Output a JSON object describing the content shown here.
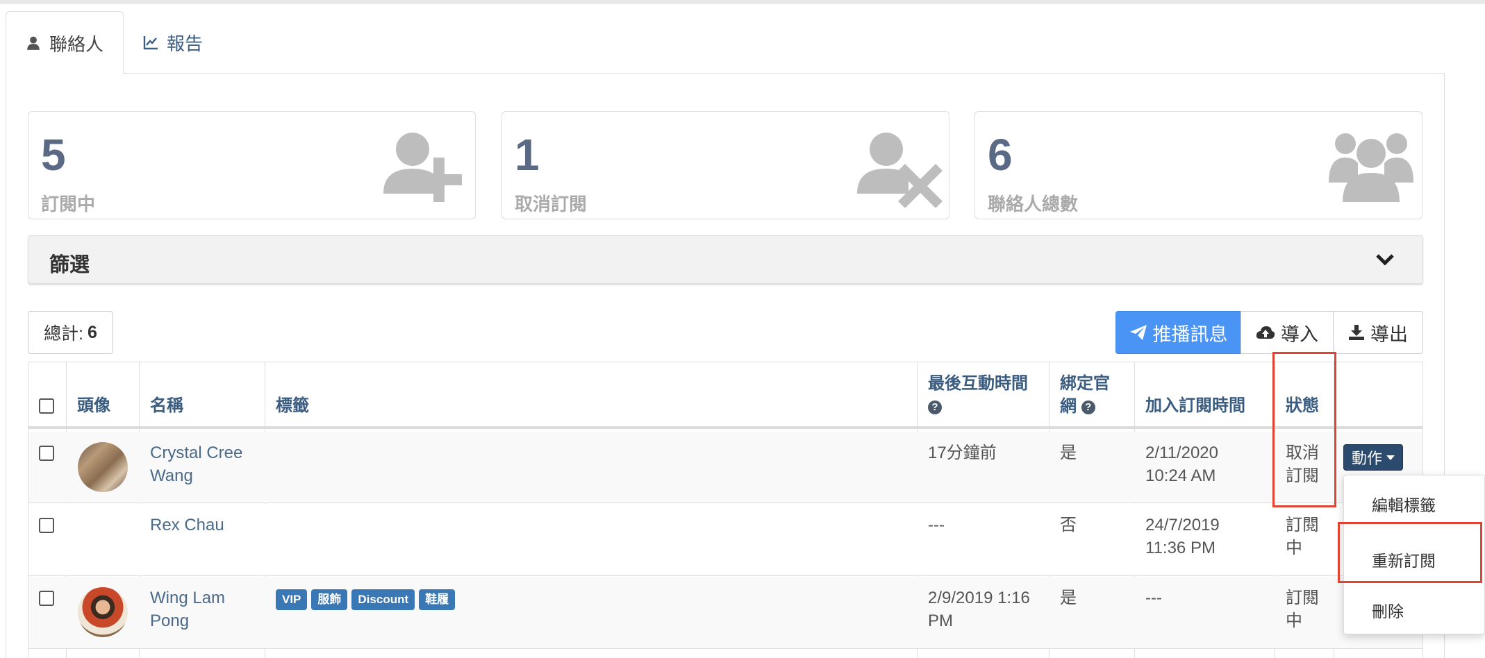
{
  "tabs": [
    {
      "label": "聯絡人",
      "icon": "user-icon",
      "active": true
    },
    {
      "label": "報告",
      "icon": "line-chart-icon",
      "active": false
    }
  ],
  "stats": [
    {
      "value": "5",
      "label": "訂閱中",
      "icon": "user-plus-icon"
    },
    {
      "value": "1",
      "label": "取消訂閱",
      "icon": "user-times-icon"
    },
    {
      "value": "6",
      "label": "聯絡人總數",
      "icon": "users-icon"
    }
  ],
  "filter": {
    "title": "篩選",
    "icon": "chevron-down-icon"
  },
  "total": {
    "label": "總計:",
    "value": "6"
  },
  "toolbar": {
    "broadcast_label": "推播訊息",
    "import_label": "導入",
    "export_label": "導出"
  },
  "table": {
    "headers": {
      "avatar": "頭像",
      "name": "名稱",
      "tags": "標籤",
      "last_interaction_1": "最後互動時間",
      "bound_1": "綁定官",
      "bound_2": "網",
      "joined": "加入訂閱時間",
      "status": "狀態"
    },
    "rows": [
      {
        "name_1": "Crystal Cree",
        "name_2": "Wang",
        "tags": [],
        "last_1": "17分鐘前",
        "last_2": "",
        "bound": "是",
        "joined_1": "2/11/2020",
        "joined_2": "10:24 AM",
        "status_1": "取消",
        "status_2": "訂閱",
        "has_avatar": true
      },
      {
        "name_1": "Rex Chau",
        "name_2": "",
        "tags": [],
        "last_1": "---",
        "last_2": "",
        "bound": "否",
        "joined_1": "24/7/2019",
        "joined_2": "11:36 PM",
        "status_1": "訂閱",
        "status_2": "中",
        "has_avatar": false
      },
      {
        "name_1": "Wing Lam",
        "name_2": "Pong",
        "tags": [
          "VIP",
          "服飾",
          "Discount",
          "鞋履"
        ],
        "last_1": "2/9/2019 1:16",
        "last_2": "PM",
        "bound": "是",
        "joined_1": "---",
        "joined_2": "",
        "status_1": "訂閱",
        "status_2": "中",
        "has_avatar": true
      }
    ]
  },
  "action": {
    "label": "動作",
    "menu": [
      "編輯標籤",
      "重新訂閱",
      "刪除"
    ]
  },
  "colors": {
    "primary": "#4a94f5",
    "tag": "#3a78b5",
    "action": "#2c4a6e",
    "highlight": "#e04430"
  }
}
